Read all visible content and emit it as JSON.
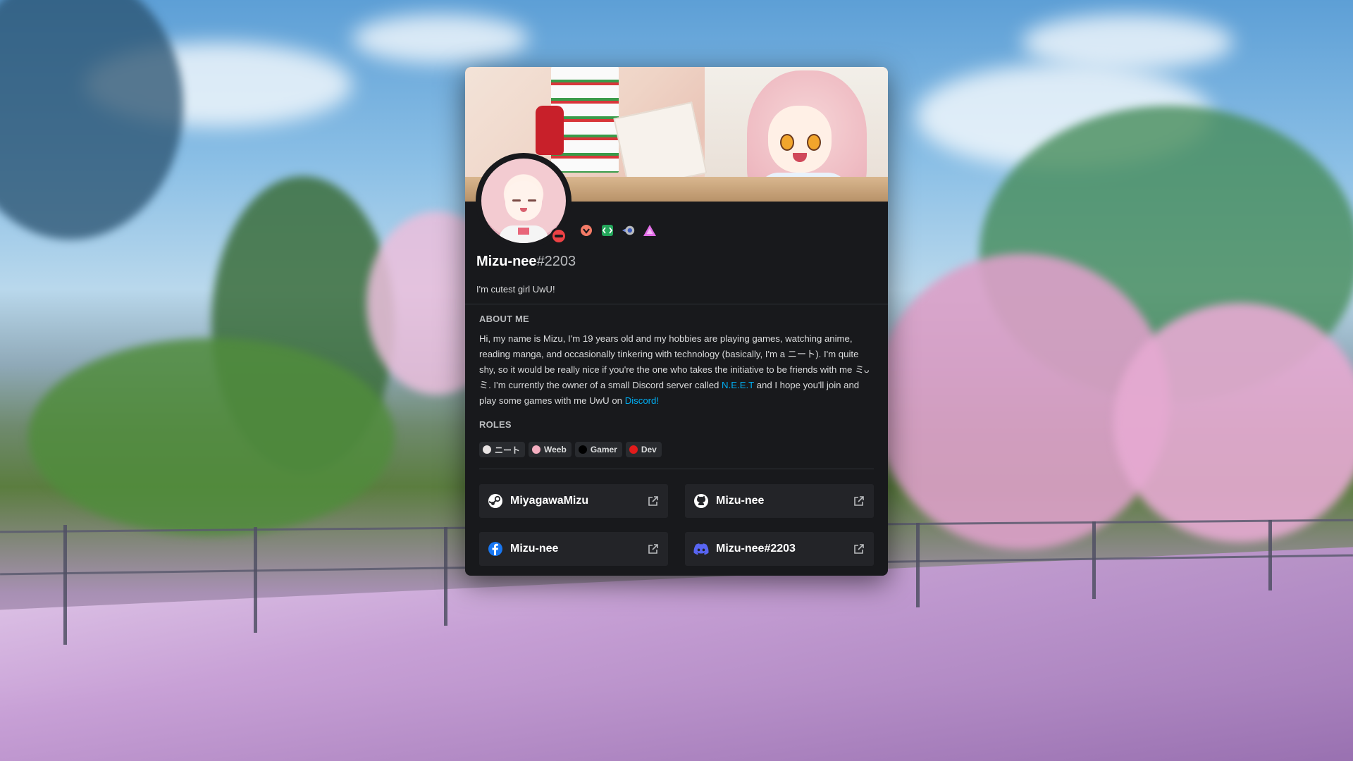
{
  "profile": {
    "username": "Mizu-nee",
    "discriminator": "#2203",
    "custom_status": "I'm cutest girl UwU!",
    "status": "dnd",
    "status_color": "#ed4245",
    "badges": [
      {
        "name": "hypesquad-balance-icon",
        "color": "#f47b67"
      },
      {
        "name": "active-developer-icon",
        "color": "#23a55a"
      },
      {
        "name": "nitro-boost-icon",
        "color": "#7289da"
      },
      {
        "name": "bug-hunter-icon",
        "color": "#e36ee8"
      }
    ]
  },
  "about": {
    "title": "About Me",
    "text_1": "Hi, my name is Mizu, I'm 19 years old and my hobbies are playing games, watching anime, reading manga, and occasionally tinkering with technology (basically, I'm a ニート). I'm quite shy, so it would be really nice if you're the one who takes the initiative to be friends with me ミᴗミ. I'm currently the owner of a small Discord server called ",
    "link_server": "N.E.E.T",
    "text_2": " and I hope you'll join and play some games with me UwU on ",
    "link_discord": "Discord!"
  },
  "roles": {
    "title": "Roles",
    "items": [
      {
        "label": "ニート",
        "color": "#e8e3e3"
      },
      {
        "label": "Weeb",
        "color": "#f4aec0"
      },
      {
        "label": "Gamer",
        "color": "#000000"
      },
      {
        "label": "Dev",
        "color": "#e21b1b"
      }
    ]
  },
  "connections": [
    {
      "service": "steam",
      "label": "MiyagawaMizu"
    },
    {
      "service": "github",
      "label": "Mizu-nee"
    },
    {
      "service": "facebook",
      "label": "Mizu-nee",
      "color": "#1877f2"
    },
    {
      "service": "discord",
      "label": "Mizu-nee#2203",
      "color": "#5865f2"
    }
  ]
}
